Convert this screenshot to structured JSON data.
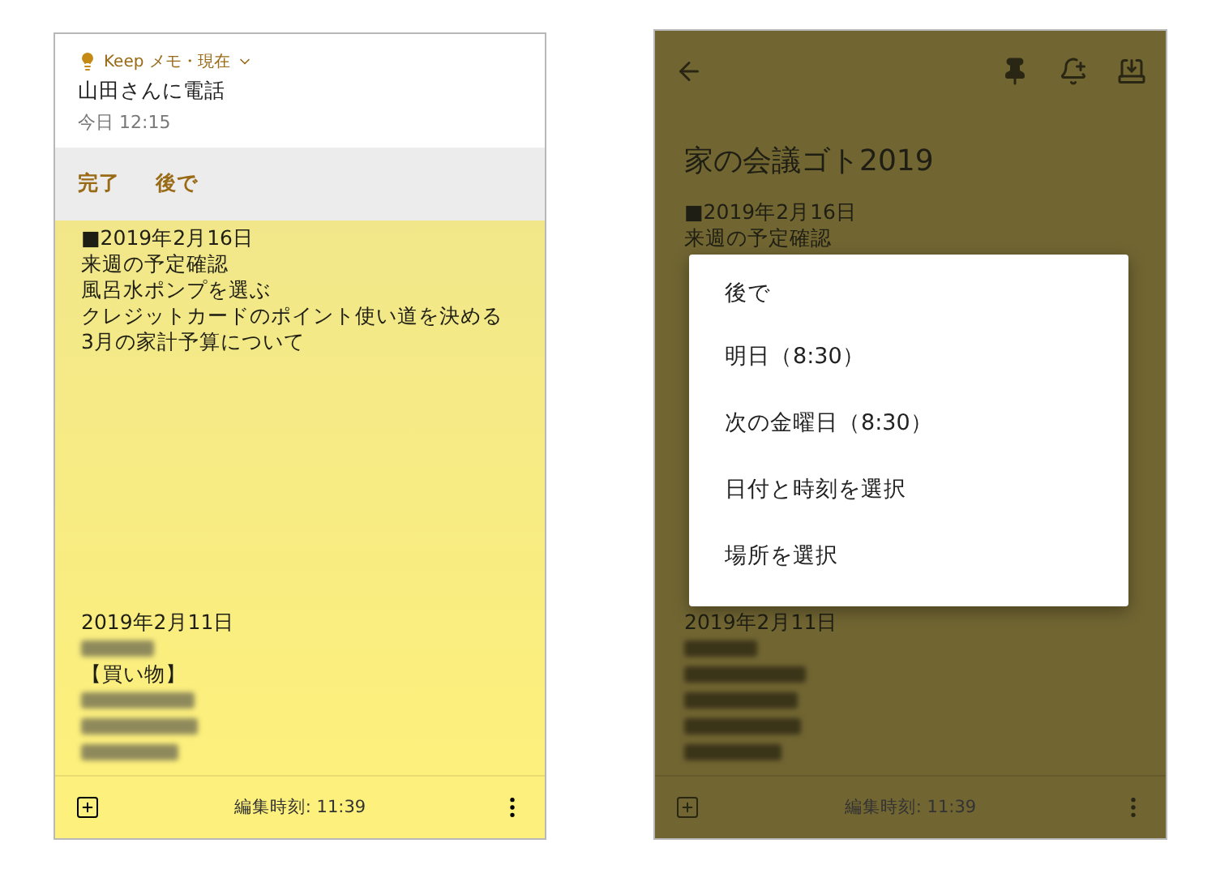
{
  "notification": {
    "header": "Keep メモ・現在",
    "title": "山田さんに電話",
    "subtitle": "今日 12:15",
    "actions": [
      "完了",
      "後で"
    ]
  },
  "left_note": {
    "blocks": [
      {
        "lines": [
          {
            "kind": "text",
            "text": "■2019年2月16日"
          },
          {
            "kind": "text",
            "text": "来週の予定確認"
          },
          {
            "kind": "text",
            "text": "風呂水ポンプを選ぶ"
          },
          {
            "kind": "text",
            "text": "クレジットカードのポイント使い道を決める"
          },
          {
            "kind": "text",
            "text": "3月の家計予算について"
          }
        ]
      },
      {
        "lines": [
          {
            "kind": "text",
            "text": "2019年2月11日"
          },
          {
            "kind": "redacted"
          },
          {
            "kind": "text",
            "text": "【買い物】"
          },
          {
            "kind": "redacted"
          },
          {
            "kind": "redacted"
          },
          {
            "kind": "redacted"
          }
        ]
      }
    ],
    "footer": "編集時刻: 11:39"
  },
  "right_note": {
    "title": "家の会議ゴト2019",
    "blocks": [
      {
        "lines": [
          {
            "kind": "text",
            "text": "■2019年2月16日"
          },
          {
            "kind": "text",
            "text": "来週の予定確認"
          }
        ]
      },
      {
        "lines": [
          {
            "kind": "text",
            "text": "2019年2月11日"
          },
          {
            "kind": "redacted"
          },
          {
            "kind": "redacted"
          },
          {
            "kind": "redacted"
          },
          {
            "kind": "redacted"
          },
          {
            "kind": "redacted"
          }
        ]
      }
    ],
    "footer": "編集時刻: 11:39"
  },
  "menu": {
    "title": "後で",
    "items": [
      "明日（8:30）",
      "次の金曜日（8:30）",
      "日付と時刻を選択",
      "場所を選択"
    ]
  }
}
